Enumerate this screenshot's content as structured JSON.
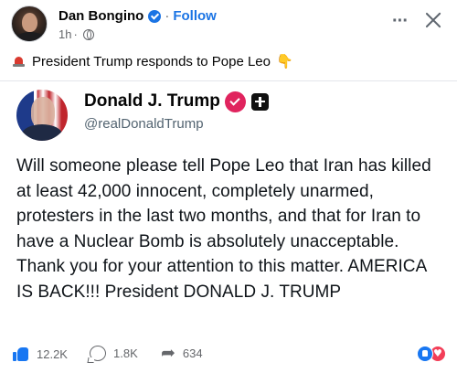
{
  "header": {
    "author_name": "Dan Bongino",
    "separator": "·",
    "follow_label": "Follow",
    "timestamp": "1h",
    "meta_separator": "·"
  },
  "post": {
    "caption": "President Trump responds to Pope Leo",
    "caption_leading_icon": "siren-icon",
    "caption_trailing_icon": "pointing-down-icon"
  },
  "embedded_tweet": {
    "display_name": "Donald J. Trump",
    "handle": "@realDonaldTrump",
    "body": "Will someone please tell Pope Leo that Iran has killed at least 42,000 innocent, completely unarmed, protesters in the last two months, and that for Iran to have a Nuclear Bomb is absolutely unacceptable. Thank you for your attention to this matter. AMERICA IS BACK!!! President DONALD J. TRUMP"
  },
  "engagement": {
    "likes": "12.2K",
    "comments": "1.8K",
    "shares": "634"
  },
  "colors": {
    "facebook_blue": "#1877f2",
    "link_blue": "#1b74e4",
    "love_red": "#f33e58",
    "truth_badge_pink": "#e0245e"
  }
}
